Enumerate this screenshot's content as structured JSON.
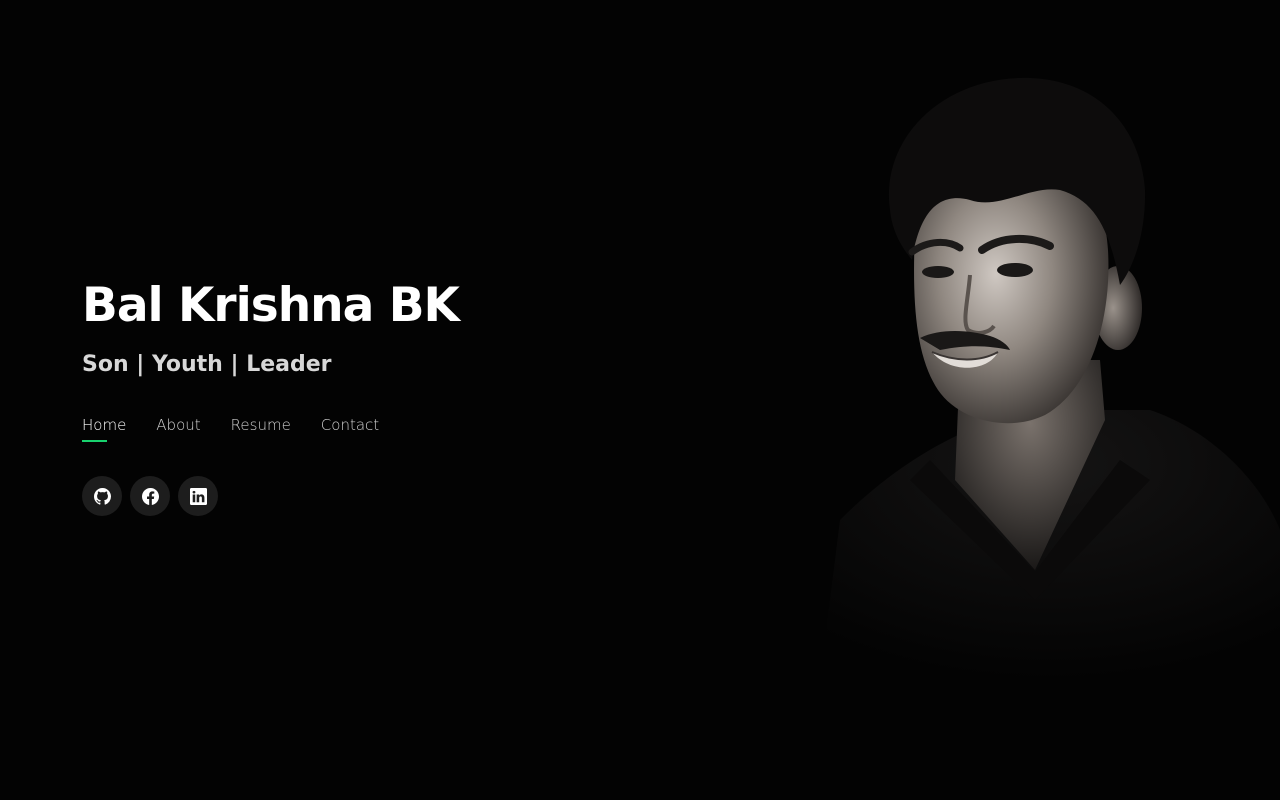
{
  "profile": {
    "name": "Bal Krishna BK",
    "tagline": "Son | Youth | Leader"
  },
  "nav": {
    "items": [
      {
        "label": "Home",
        "active": true
      },
      {
        "label": "About",
        "active": false
      },
      {
        "label": "Resume",
        "active": false
      },
      {
        "label": "Contact",
        "active": false
      }
    ]
  },
  "social": [
    {
      "icon": "github-icon"
    },
    {
      "icon": "facebook-icon"
    },
    {
      "icon": "linkedin-icon"
    }
  ],
  "colors": {
    "background": "#030303",
    "accent": "#18d26e",
    "social_bg": "#1d1d1d",
    "text": "#ffffff"
  }
}
